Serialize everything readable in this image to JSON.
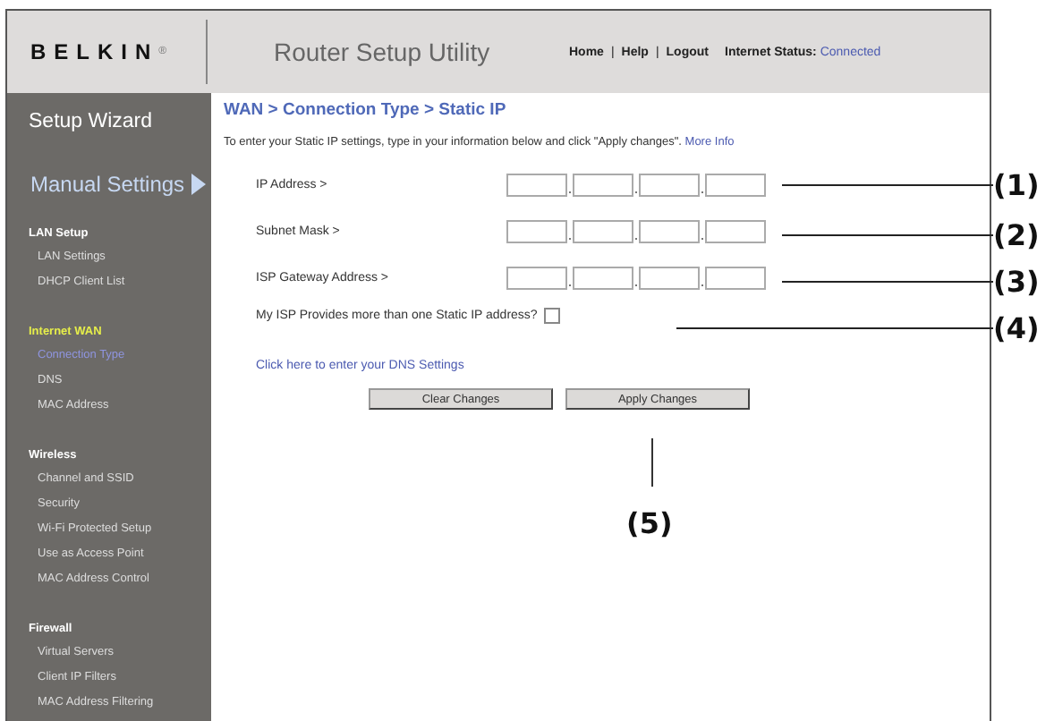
{
  "header": {
    "logo": "BELKIN",
    "logo_mark": "®",
    "title": "Router Setup Utility",
    "nav": [
      "Home",
      "Help",
      "Logout"
    ],
    "nav_separator": "|",
    "status_label": "Internet Status:",
    "status_value": "Connected"
  },
  "sidebar": {
    "wizard": "Setup Wizard",
    "manual": "Manual Settings",
    "sections": [
      {
        "title": "LAN Setup",
        "selected": false,
        "items": [
          {
            "label": "LAN Settings",
            "selected": false
          },
          {
            "label": "DHCP Client List",
            "selected": false
          }
        ]
      },
      {
        "title": "Internet WAN",
        "selected": true,
        "items": [
          {
            "label": "Connection Type",
            "selected": true
          },
          {
            "label": "DNS",
            "selected": false
          },
          {
            "label": "MAC Address",
            "selected": false
          }
        ]
      },
      {
        "title": "Wireless",
        "selected": false,
        "items": [
          {
            "label": "Channel and SSID",
            "selected": false
          },
          {
            "label": "Security",
            "selected": false
          },
          {
            "label": "Wi-Fi Protected Setup",
            "selected": false
          },
          {
            "label": "Use as Access Point",
            "selected": false
          },
          {
            "label": "MAC Address Control",
            "selected": false
          }
        ]
      },
      {
        "title": "Firewall",
        "selected": false,
        "items": [
          {
            "label": "Virtual Servers",
            "selected": false
          },
          {
            "label": "Client IP Filters",
            "selected": false
          },
          {
            "label": "MAC Address Filtering",
            "selected": false
          }
        ]
      }
    ]
  },
  "content": {
    "breadcrumb": "WAN > Connection Type > Static IP",
    "intro": "To enter your Static IP settings, type in your information below and click \"Apply changes\".",
    "intro_link": "More Info",
    "fields": [
      {
        "label": "IP Address >"
      },
      {
        "label": "Subnet Mask >"
      },
      {
        "label": "ISP Gateway Address >"
      }
    ],
    "multi_ip": {
      "label": "My ISP Provides more than one Static IP address?",
      "checked": false
    },
    "dns_link": "Click here to enter your DNS Settings",
    "buttons": [
      "Clear Changes",
      "Apply Changes"
    ]
  },
  "callouts": [
    {
      "label": "(1)"
    },
    {
      "label": "(2)"
    },
    {
      "label": "(3)"
    },
    {
      "label": "(4)"
    },
    {
      "label": "(5)"
    }
  ]
}
